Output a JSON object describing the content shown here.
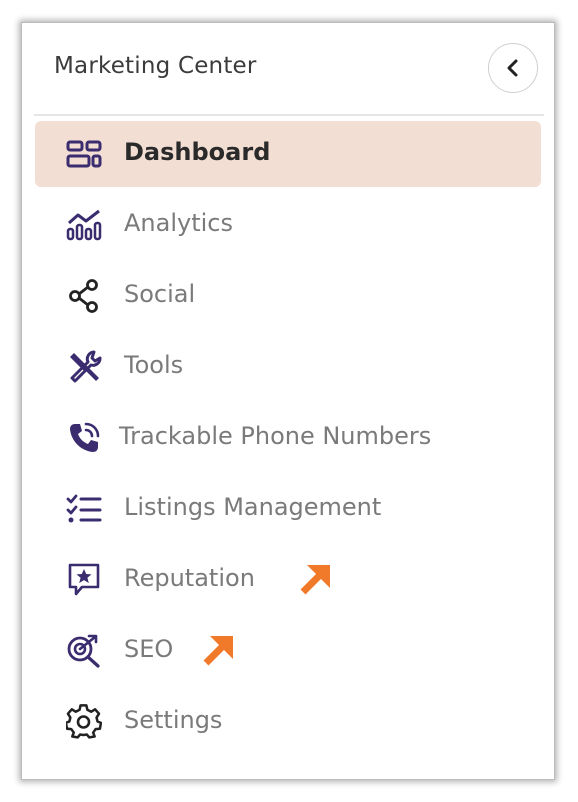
{
  "header": {
    "title": "Marketing Center",
    "collapse_icon": "chevron-left-icon"
  },
  "nav": {
    "items": [
      {
        "label": "Dashboard",
        "icon": "dashboard-icon",
        "active": true
      },
      {
        "label": "Analytics",
        "icon": "analytics-icon"
      },
      {
        "label": "Social",
        "icon": "share-icon"
      },
      {
        "label": "Tools",
        "icon": "tools-icon"
      },
      {
        "label": "Trackable Phone Numbers",
        "icon": "phone-call-icon"
      },
      {
        "label": "Listings Management",
        "icon": "checklist-icon"
      },
      {
        "label": "Reputation",
        "icon": "star-message-icon",
        "external": true
      },
      {
        "label": "SEO",
        "icon": "seo-target-icon",
        "external": true
      },
      {
        "label": "Settings",
        "icon": "gear-icon"
      }
    ]
  },
  "colors": {
    "active_bg": "#f3ded4",
    "icon": "#3a2c6e",
    "external_arrow": "#f07a2a",
    "label": "#7a7a7a",
    "active_label": "#2a2a2a"
  }
}
